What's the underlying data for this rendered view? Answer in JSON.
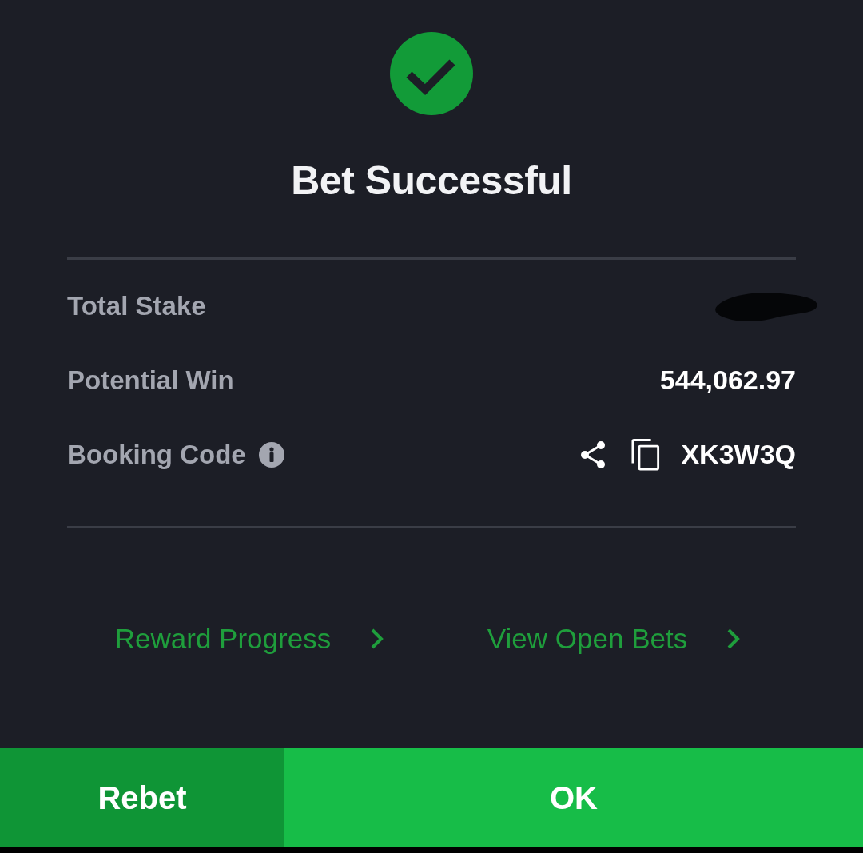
{
  "status": {
    "title": "Bet Successful"
  },
  "details": [
    {
      "kind": "redacted",
      "label": "Total Stake"
    },
    {
      "kind": "amount",
      "label": "Potential Win",
      "value": "544,062.97"
    },
    {
      "kind": "code",
      "label": "Booking Code",
      "value": "XK3W3Q"
    }
  ],
  "links": [
    {
      "label": "Reward Progress"
    },
    {
      "label": "View Open Bets"
    }
  ],
  "buttons": [
    {
      "kind": "secondary",
      "label": "Rebet"
    },
    {
      "kind": "primary",
      "label": "OK"
    }
  ]
}
